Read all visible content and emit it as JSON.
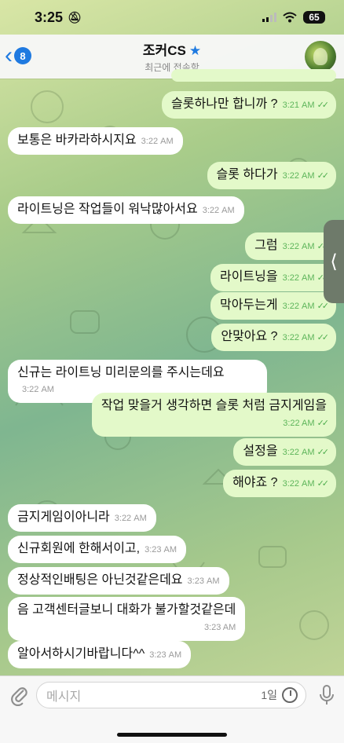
{
  "status_bar": {
    "time": "3:25",
    "battery": "65"
  },
  "header": {
    "back_badge": "8",
    "title": "조커CS",
    "subtitle": "최근에 접속함"
  },
  "messages": [
    {
      "dir": "out",
      "text": "슬롯하나만 합니까 ?",
      "time": "3:21 AM",
      "read": true
    },
    {
      "dir": "in",
      "text": "보통은 바카라하시지요",
      "time": "3:22 AM"
    },
    {
      "dir": "out",
      "text": "슬롯 하다가",
      "time": "3:22 AM",
      "read": true
    },
    {
      "dir": "in",
      "text": "라이트닝은 작업들이 워낙많아서요",
      "time": "3:22 AM"
    },
    {
      "dir": "out",
      "text": "그럼",
      "time": "3:22 AM",
      "read": true
    },
    {
      "dir": "out",
      "text": "라이트닝을",
      "time": "3:22 AM",
      "read": true
    },
    {
      "dir": "out",
      "text": "막아두는게",
      "time": "3:22 AM",
      "read": true
    },
    {
      "dir": "out",
      "text": "안맞아요 ?",
      "time": "3:22 AM",
      "read": true
    },
    {
      "dir": "in",
      "text": "신규는 라이트닝 미리문의를 주시는데요",
      "time": "3:22 AM"
    },
    {
      "dir": "out",
      "text": "작업 맞을거 생각하면 슬롯 처럼 금지게임을",
      "time": "3:22 AM",
      "read": true
    },
    {
      "dir": "out",
      "text": "설정을",
      "time": "3:22 AM",
      "read": true
    },
    {
      "dir": "out",
      "text": "해야죠 ?",
      "time": "3:22 AM",
      "read": true
    },
    {
      "dir": "in",
      "text": "금지게임이아니라",
      "time": "3:22 AM"
    },
    {
      "dir": "in",
      "text": "신규회원에 한해서이고,",
      "time": "3:23 AM"
    },
    {
      "dir": "in",
      "text": "정상적인배팅은 아닌것같은데요",
      "time": "3:23 AM"
    },
    {
      "dir": "in",
      "text": "음 고객센터글보니 대화가 불가할것같은데",
      "time": "3:23 AM"
    },
    {
      "dir": "in",
      "text": "알아서하시기바랍니다^^",
      "time": "3:23 AM"
    }
  ],
  "input": {
    "placeholder": "메시지",
    "timer_label": "1일"
  },
  "icons": {
    "back": "chevron-left-icon",
    "verified": "star-icon",
    "attach": "paperclip-icon",
    "timer": "clock-icon",
    "mic": "microphone-icon"
  },
  "colors": {
    "accent": "#1f7ae0",
    "outgoing_bubble": "#e3f9c9",
    "incoming_bubble": "#ffffff",
    "read_tick": "#4fae4e"
  }
}
